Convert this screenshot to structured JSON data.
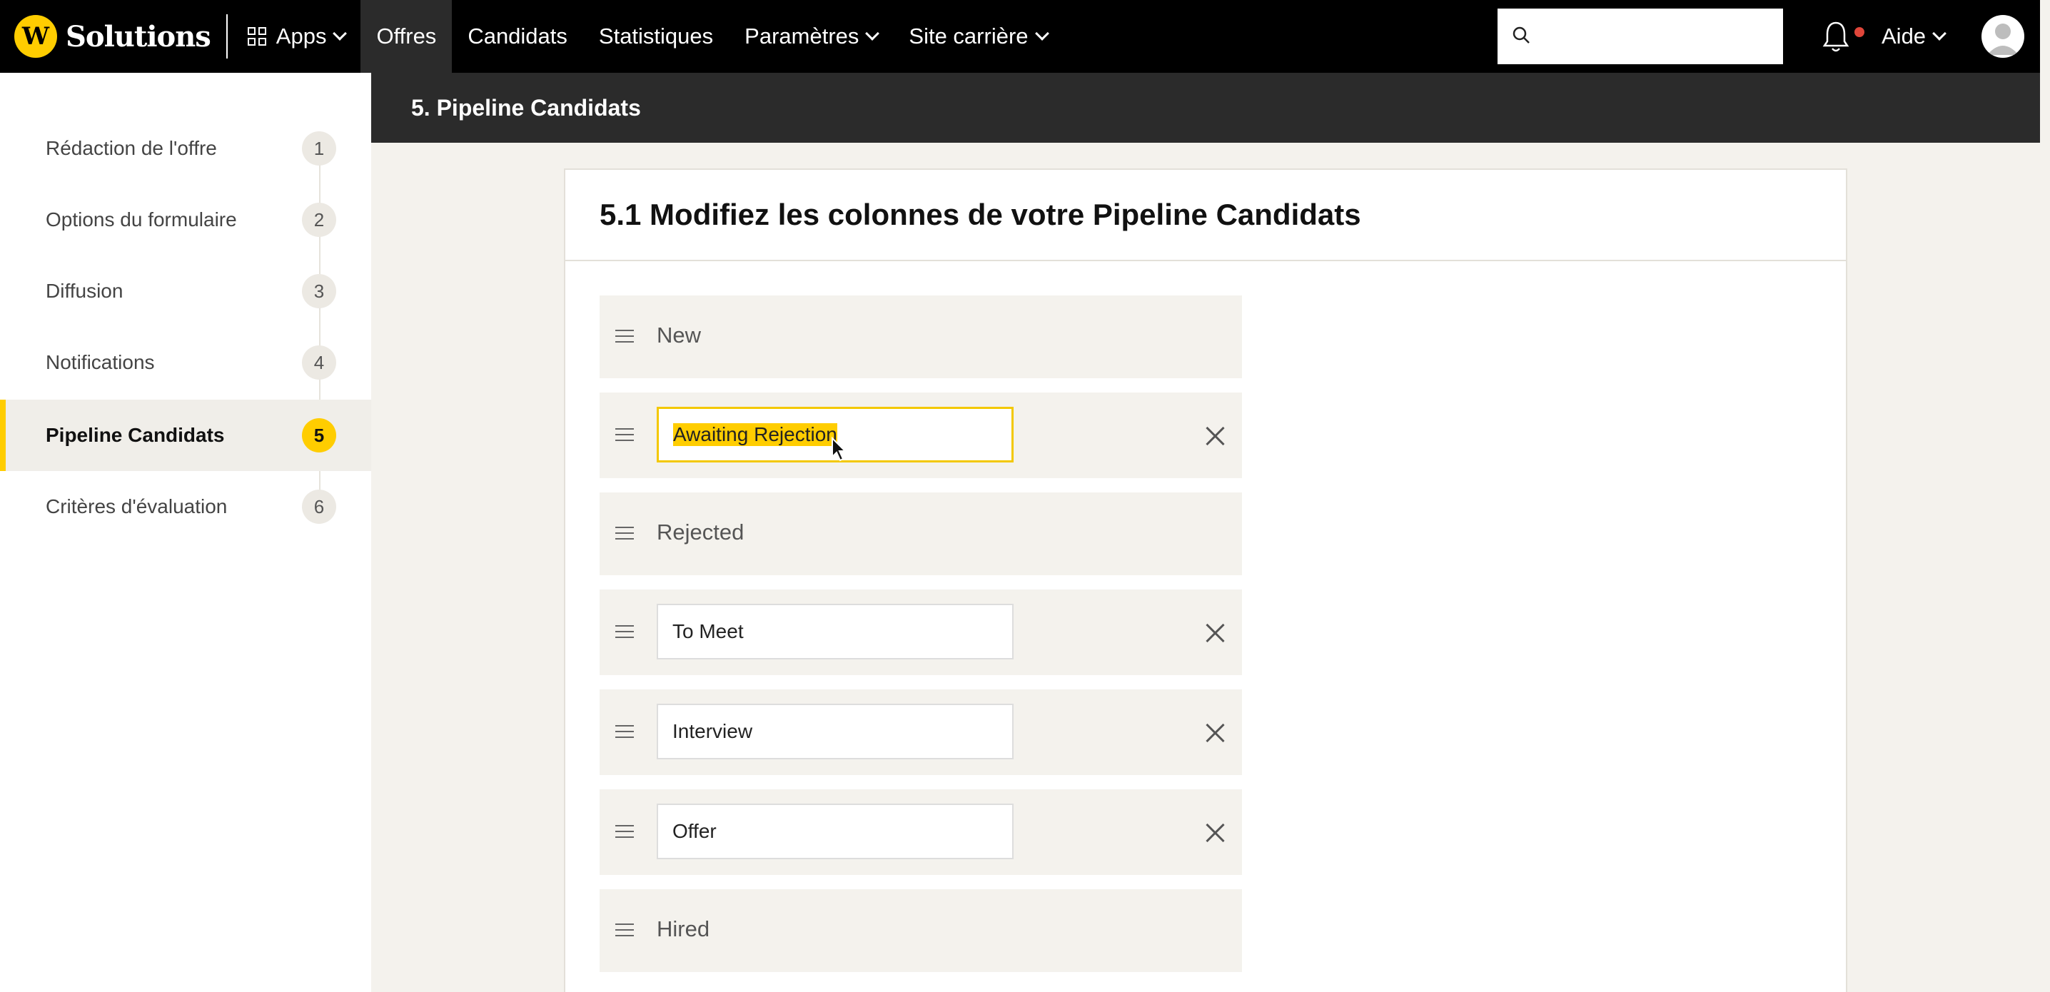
{
  "topnav": {
    "brand": "Solutions",
    "logo_letter": "W",
    "items": [
      {
        "label": "Apps",
        "dropdown": true
      },
      {
        "label": "Offres",
        "active": true
      },
      {
        "label": "Candidats"
      },
      {
        "label": "Statistiques"
      },
      {
        "label": "Paramètres",
        "dropdown": true
      },
      {
        "label": "Site carrière",
        "dropdown": true
      }
    ],
    "search_value": "",
    "help_label": "Aide"
  },
  "sidebar": {
    "items": [
      {
        "label": "Rédaction de l'offre",
        "num": "1"
      },
      {
        "label": "Options du formulaire",
        "num": "2"
      },
      {
        "label": "Diffusion",
        "num": "3"
      },
      {
        "label": "Notifications",
        "num": "4"
      },
      {
        "label": "Pipeline Candidats",
        "num": "5",
        "active": true
      },
      {
        "label": "Critères d'évaluation",
        "num": "6"
      }
    ]
  },
  "section": {
    "title": "5. Pipeline Candidats"
  },
  "card": {
    "title": "5.1 Modifiez les colonnes de votre Pipeline Candidats",
    "columns": [
      {
        "label": "New",
        "editable": false
      },
      {
        "label": "Awaiting Rejection",
        "editable": true,
        "focused": true
      },
      {
        "label": "Rejected",
        "editable": false
      },
      {
        "label": "To Meet",
        "editable": true
      },
      {
        "label": "Interview",
        "editable": true
      },
      {
        "label": "Offer",
        "editable": true
      },
      {
        "label": "Hired",
        "editable": false
      }
    ]
  },
  "colors": {
    "accent": "#ffcd00",
    "nav_bg": "#000000",
    "section_bg": "#2b2b2b",
    "page_bg": "#f4f2ed"
  }
}
